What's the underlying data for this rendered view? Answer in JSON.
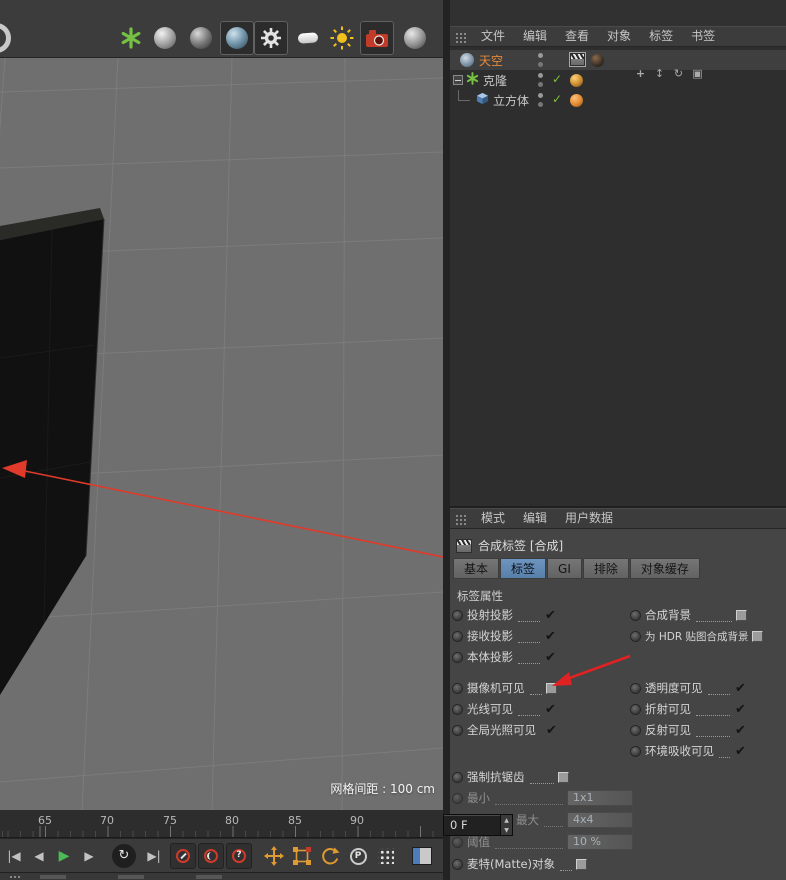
{
  "colors": {
    "tab_active": "#567fa9",
    "selected_object_text": "#e78a3a",
    "annotation_arrow": "#e02222",
    "play_button": "#4cbb53",
    "viewport_bg": "#6f6f6f"
  },
  "top_toolbar": {
    "icon_names": [
      "mograph-cloner-icon",
      "sphere-icon",
      "sphere-shaded-icon",
      "sphere-textured-icon",
      "settings-gear-icon",
      "floor-icon",
      "light-icon",
      "camera-icon",
      "sphere-gray-icon"
    ]
  },
  "object_manager": {
    "menu": [
      {
        "label": "文件"
      },
      {
        "label": "编辑"
      },
      {
        "label": "查看"
      },
      {
        "label": "对象"
      },
      {
        "label": "标签"
      },
      {
        "label": "书签"
      }
    ],
    "nav": {
      "pan": "+",
      "zoom": "↕",
      "rotate": "↻",
      "maximize": "▣"
    },
    "objects": [
      {
        "label": "天空"
      },
      {
        "label": "克隆"
      },
      {
        "label": "立方体"
      }
    ],
    "enable_glyph": "✓"
  },
  "viewport": {
    "grid_spacing": "网格间距 : 100 cm"
  },
  "timeline": {
    "ticks": [
      {
        "label": "65"
      },
      {
        "label": "70"
      },
      {
        "label": "75"
      },
      {
        "label": "80"
      },
      {
        "label": "85"
      },
      {
        "label": "90"
      }
    ],
    "frame_field": "0 F",
    "spin_up": "▲",
    "spin_down": "▼"
  },
  "transport": {
    "goto_start": "|◀",
    "prev_frame": "◀",
    "play": "▶",
    "next_frame": "▶",
    "loop": "↻",
    "goto_end": "▶|",
    "help": "?",
    "p_tool": "P"
  },
  "attribute_manager": {
    "menu": [
      {
        "label": "模式"
      },
      {
        "label": "编辑"
      },
      {
        "label": "用户数据"
      }
    ],
    "title": "合成标签 [合成]",
    "tabs": [
      {
        "label": "基本"
      },
      {
        "label": "标签"
      },
      {
        "label": "GI"
      },
      {
        "label": "排除"
      },
      {
        "label": "对象缓存"
      }
    ],
    "active_tab": "标签",
    "section": "标签属性",
    "left": [
      {
        "label": "投射投影",
        "checked": true
      },
      {
        "label": "接收投影",
        "checked": true
      },
      {
        "label": "本体投影",
        "checked": true
      },
      {
        "label": "摄像机可见",
        "checked": false
      },
      {
        "label": "光线可见",
        "checked": true
      },
      {
        "label": "全局光照可见",
        "checked": true
      }
    ],
    "right": [
      {
        "label": "合成背景",
        "checked": false
      },
      {
        "label": "为 HDR 贴图合成背景",
        "checked": false
      },
      {
        "label": "透明度可见",
        "checked": true
      },
      {
        "label": "折射可见",
        "checked": true
      },
      {
        "label": "反射可见",
        "checked": true
      },
      {
        "label": "环境吸收可见",
        "checked": true
      }
    ],
    "antialias": {
      "label": "强制抗锯齿",
      "checked": false
    },
    "fields": [
      {
        "label": "最小",
        "value": "1x1"
      },
      {
        "label": "最大",
        "value": "4x4"
      },
      {
        "label": "阈值",
        "value": "10 %"
      }
    ],
    "matte": {
      "label": "麦特(Matte)对象",
      "checked": false
    }
  }
}
